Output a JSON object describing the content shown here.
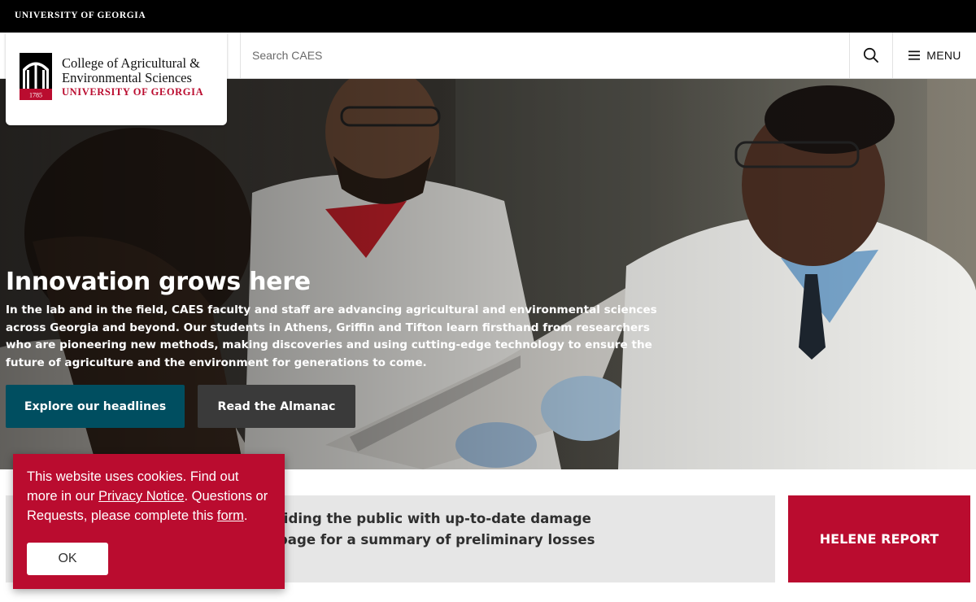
{
  "topbar": {
    "university_label": "UNIVERSITY OF GEORGIA"
  },
  "logo": {
    "line1": "College of Agricultural &",
    "line2": "Environmental Sciences",
    "line3": "UNIVERSITY OF GEORGIA",
    "seal_year": "1785"
  },
  "header": {
    "search_placeholder": "Search CAES",
    "search_icon": "search-icon",
    "menu_icon": "hamburger-icon",
    "menu_label": "MENU"
  },
  "hero": {
    "title": "Innovation grows here",
    "body": "In the lab and in the field, CAES faculty and staff are advancing agricultural and environmental sciences across Georgia and beyond. Our students in Athens, Griffin and Tifton learn firsthand from researchers who are pioneering new methods, making discoveries and using cutting-edge technology to ensure the future of agriculture and the environment for generations to come.",
    "primary_button": "Explore our headlines",
    "secondary_button": "Read the Almanac"
  },
  "alert": {
    "line1": "vironmental Sciences is providing the public with up-to-date damage",
    "line2": "Visit the Helene Report webpage for a summary of preliminary losses",
    "button": "HELENE REPORT"
  },
  "cookie": {
    "text_1": "This website uses cookies. Find out more in our ",
    "privacy_link": "Privacy Notice",
    "text_2": ". Questions or Requests, please complete this ",
    "form_link": "form",
    "text_3": ".",
    "ok_label": "OK"
  },
  "colors": {
    "brand_red": "#ba0c2f",
    "primary_teal": "#004e60",
    "secondary_gray": "#3a3a3a",
    "top_bar": "#000000"
  }
}
